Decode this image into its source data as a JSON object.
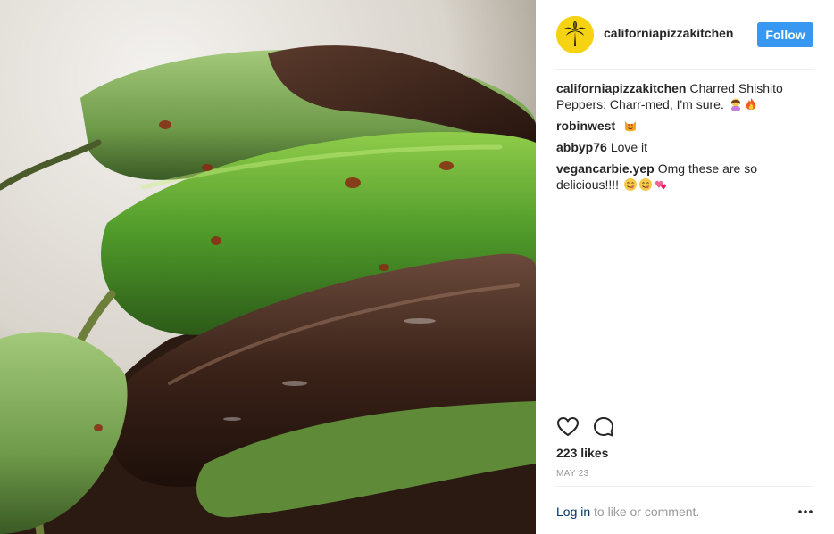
{
  "post": {
    "photo_subject": "charred shishito peppers",
    "account": {
      "username": "californiapizzakitchen",
      "follow_label": "Follow",
      "avatar_icon": "palm-tree-icon",
      "avatar_color": "#f5d312"
    },
    "comments": [
      {
        "user": "californiapizzakitchen",
        "text": "Charred Shishito Peppers: Charr-med, I'm sure.",
        "emojis": [
          "woman-tipping-hand-emoji",
          "fire-emoji"
        ]
      },
      {
        "user": "robinwest",
        "text": "",
        "emojis": [
          "heart-eyes-cat-emoji"
        ]
      },
      {
        "user": "abbyp76",
        "text": "Love it",
        "emojis": []
      },
      {
        "user": "vegancarbie.yep",
        "text": "Omg these are so delicious!!!!",
        "emojis": [
          "yum-face-emoji",
          "yum-face-emoji",
          "two-hearts-emoji"
        ]
      }
    ],
    "actions": {
      "like_icon": "heart-icon",
      "comment_icon": "comment-bubble-icon"
    },
    "likes_text": "223 likes",
    "date_text": "MAY 23",
    "login": {
      "link_text": "Log in",
      "suffix_text": " to like or comment.",
      "more_icon": "more-options-icon"
    },
    "colors": {
      "accent": "#3897f0",
      "link": "#003569",
      "muted": "#999999"
    }
  }
}
